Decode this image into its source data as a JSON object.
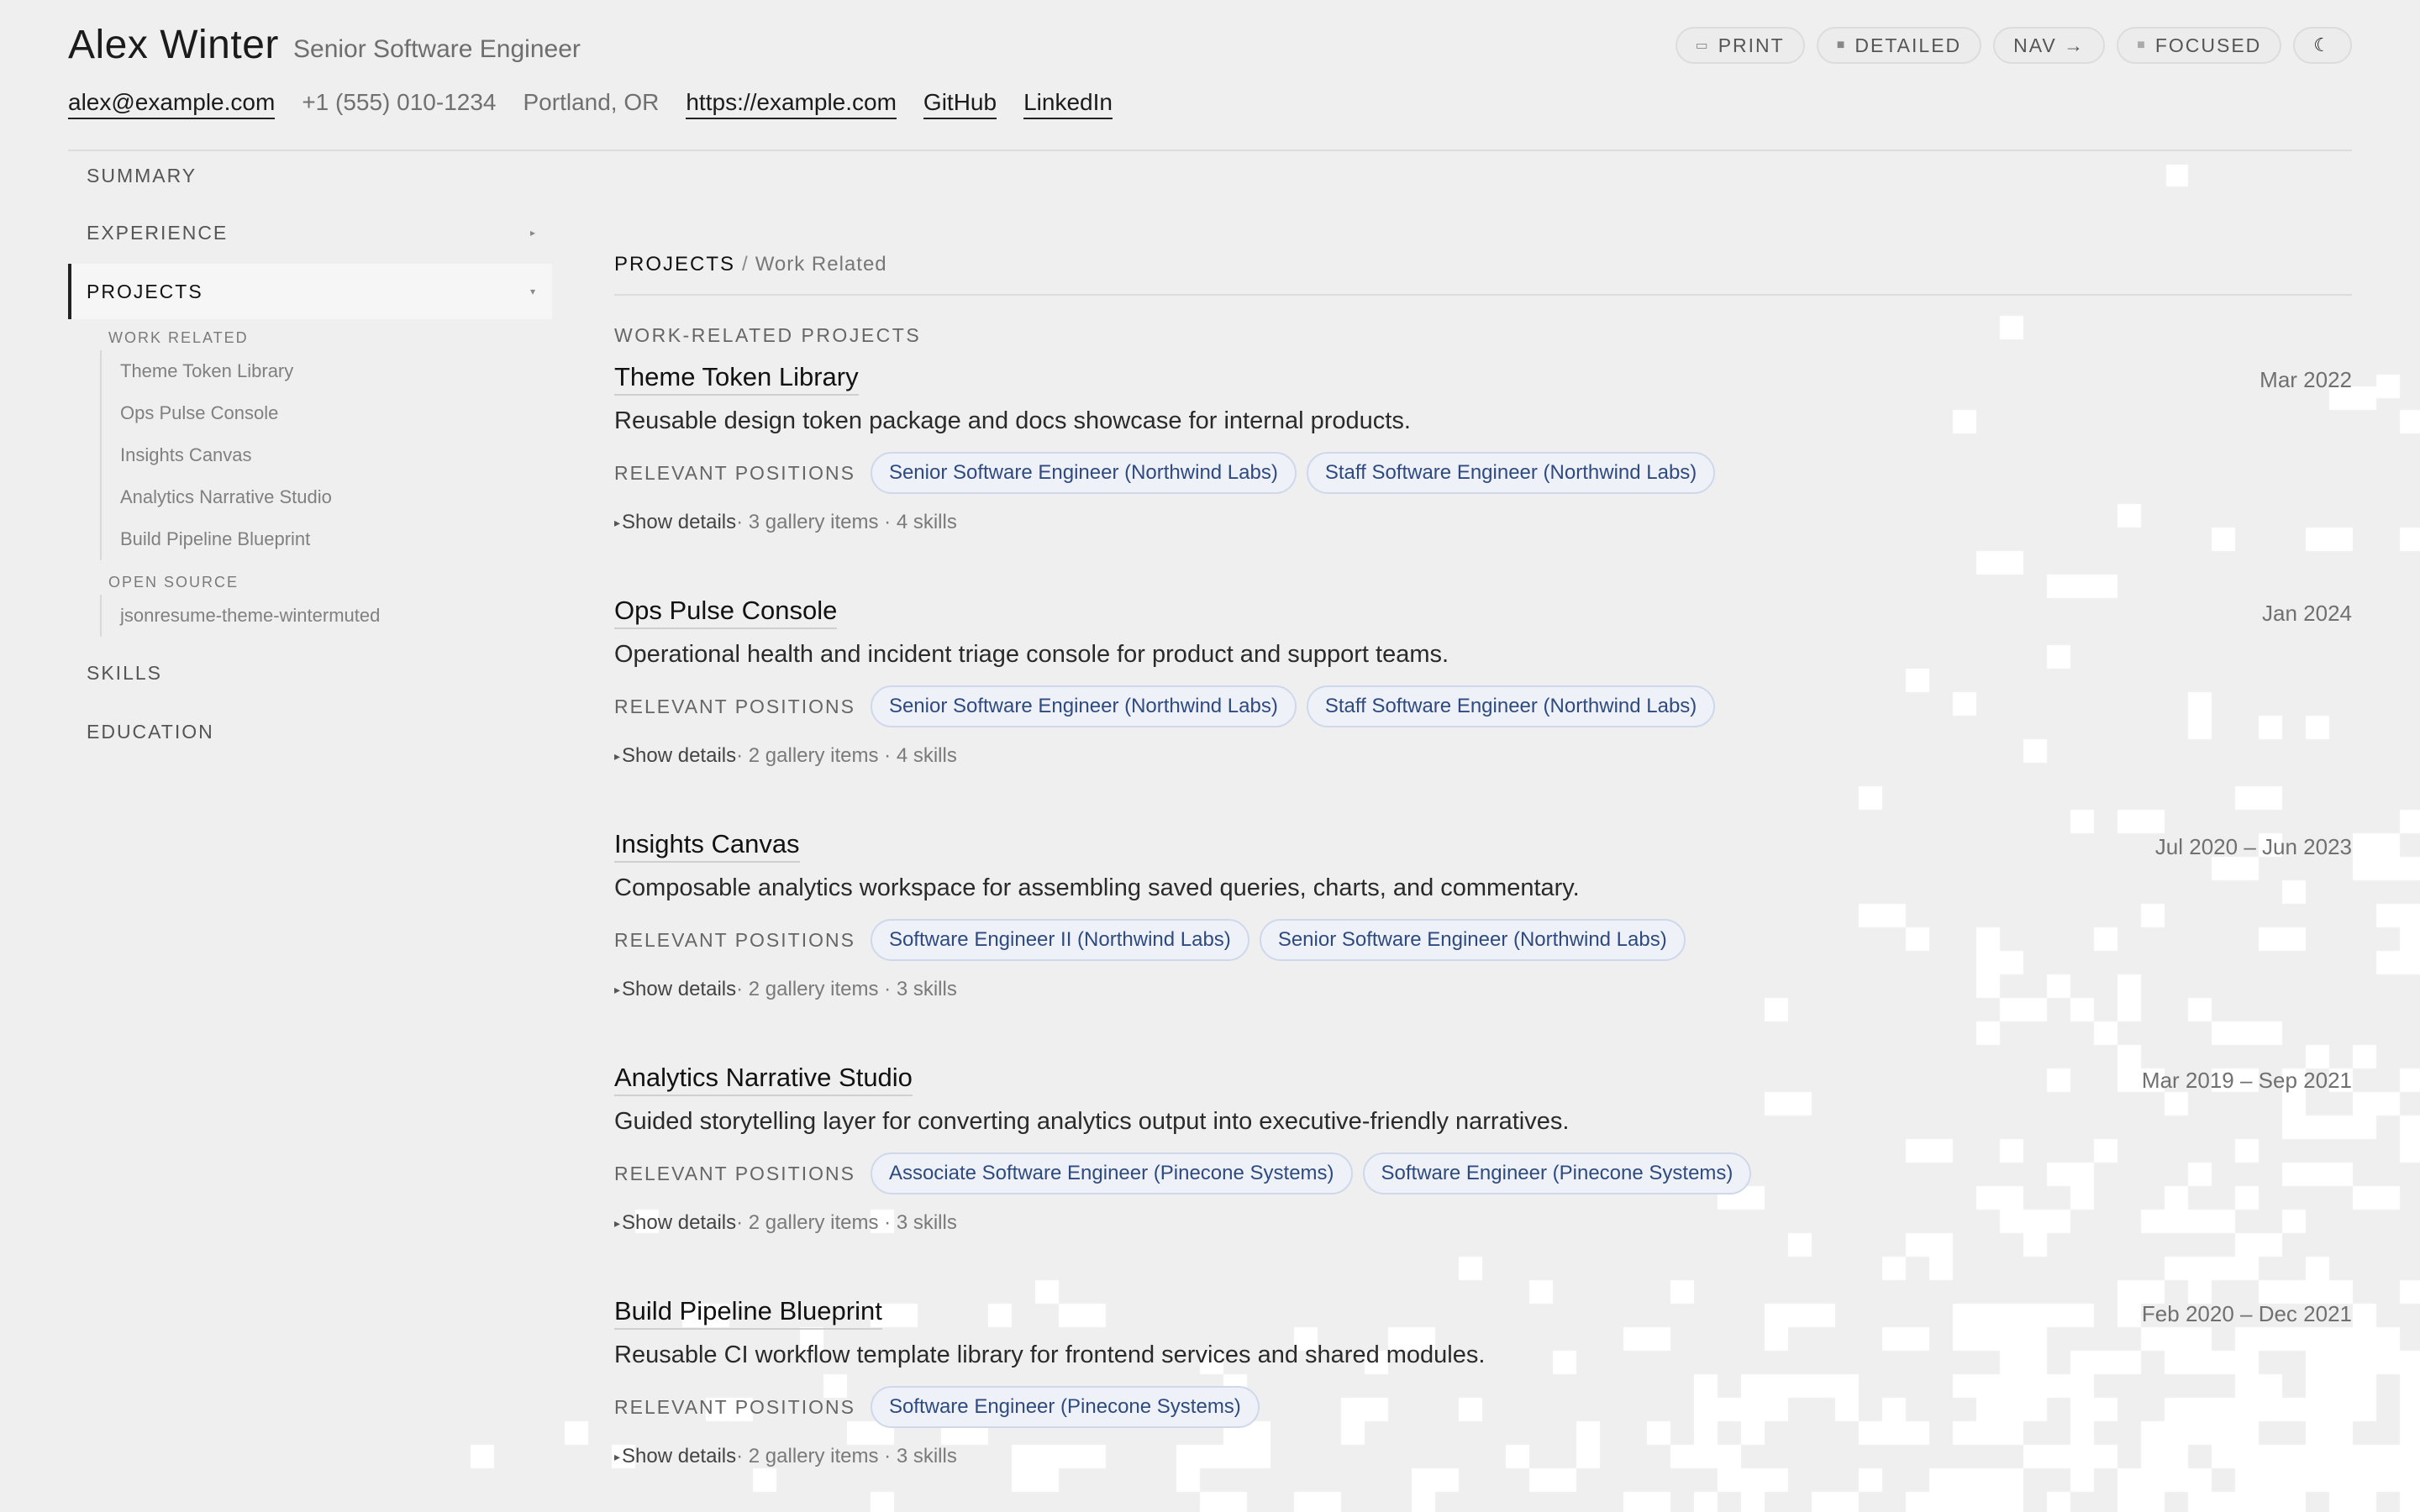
{
  "header": {
    "name": "Alex Winter",
    "role": "Senior Software Engineer",
    "email": "alex@example.com",
    "phone": "+1 (555) 010-1234",
    "location": "Portland, OR",
    "website": "https://example.com",
    "github": "GitHub",
    "linkedin": "LinkedIn"
  },
  "toolbar": {
    "print": "PRINT",
    "detailed": "DETAILED",
    "nav": "NAV →",
    "focused": "FOCUSED",
    "theme_icon": "☾",
    "icons": {
      "print": "printer-icon",
      "detailed": "square-icon",
      "focused": "square-icon",
      "theme": "moon-icon"
    }
  },
  "sidebar": {
    "summary": "SUMMARY",
    "experience": "EXPERIENCE",
    "projects": "PROJECTS",
    "skills": "SKILLS",
    "education": "EDUCATION",
    "groups": [
      {
        "heading": "WORK RELATED",
        "items": [
          "Theme Token Library",
          "Ops Pulse Console",
          "Insights Canvas",
          "Analytics Narrative Studio",
          "Build Pipeline Blueprint"
        ]
      },
      {
        "heading": "OPEN SOURCE",
        "items": [
          "jsonresume-theme-wintermuted"
        ]
      }
    ]
  },
  "main": {
    "crumb_section": "PROJECTS",
    "crumb_separator": "/",
    "crumb_sub": "Work Related",
    "section_title": "WORK-RELATED PROJECTS",
    "positions_label": "RELEVANT POSITIONS",
    "show_details": "Show details",
    "projects": [
      {
        "title": "Theme Token Library",
        "date": "Mar 2022",
        "desc": "Reusable design token package and docs showcase for internal products.",
        "positions": [
          "Senior Software Engineer (Northwind Labs)",
          "Staff Software Engineer (Northwind Labs)"
        ],
        "meta": " · 3 gallery items · 4 skills"
      },
      {
        "title": "Ops Pulse Console",
        "date": "Jan 2024",
        "desc": "Operational health and incident triage console for product and support teams.",
        "positions": [
          "Senior Software Engineer (Northwind Labs)",
          "Staff Software Engineer (Northwind Labs)"
        ],
        "meta": " · 2 gallery items · 4 skills"
      },
      {
        "title": "Insights Canvas",
        "date": "Jul 2020 – Jun 2023",
        "desc": "Composable analytics workspace for assembling saved queries, charts, and commentary.",
        "positions": [
          "Software Engineer II (Northwind Labs)",
          "Senior Software Engineer (Northwind Labs)"
        ],
        "meta": " · 2 gallery items · 3 skills"
      },
      {
        "title": "Analytics Narrative Studio",
        "date": "Mar 2019 – Sep 2021",
        "desc": "Guided storytelling layer for converting analytics output into executive-friendly narratives.",
        "positions": [
          "Associate Software Engineer (Pinecone Systems)",
          "Software Engineer (Pinecone Systems)"
        ],
        "meta": " · 2 gallery items · 3 skills"
      },
      {
        "title": "Build Pipeline Blueprint",
        "date": "Feb 2020 – Dec 2021",
        "desc": "Reusable CI workflow template library for frontend services and shared modules.",
        "positions": [
          "Software Engineer (Pinecone Systems)"
        ],
        "meta": " · 2 gallery items · 3 skills"
      }
    ]
  },
  "colors": {
    "background": "#efefef",
    "accent_pill_text": "#2e4a7f",
    "accent_pill_bg": "#eef2f8",
    "pixel": "#ffffff"
  }
}
